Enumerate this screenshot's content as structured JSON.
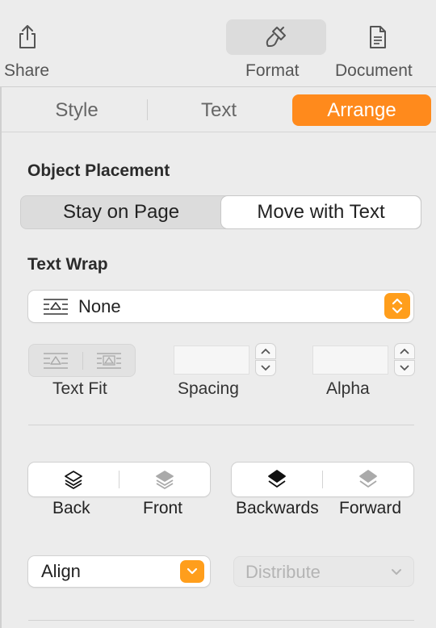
{
  "toolbar": {
    "share_label": "Share",
    "format_label": "Format",
    "document_label": "Document"
  },
  "tabs": [
    {
      "label": "Style"
    },
    {
      "label": "Text"
    },
    {
      "label": "Arrange"
    }
  ],
  "object_placement": {
    "heading": "Object Placement",
    "options": [
      "Stay on Page",
      "Move with Text"
    ],
    "selected": "Move with Text"
  },
  "text_wrap": {
    "heading": "Text Wrap",
    "value": "None",
    "text_fit_label": "Text Fit",
    "spacing_label": "Spacing",
    "spacing_value": "",
    "alpha_label": "Alpha",
    "alpha_value": ""
  },
  "layers": {
    "back_label": "Back",
    "front_label": "Front",
    "backwards_label": "Backwards",
    "forward_label": "Forward"
  },
  "align": {
    "label": "Align",
    "distribute_label": "Distribute"
  },
  "colors": {
    "accent": "#ff8a1c",
    "popup_accent": "#ff9e1c"
  }
}
